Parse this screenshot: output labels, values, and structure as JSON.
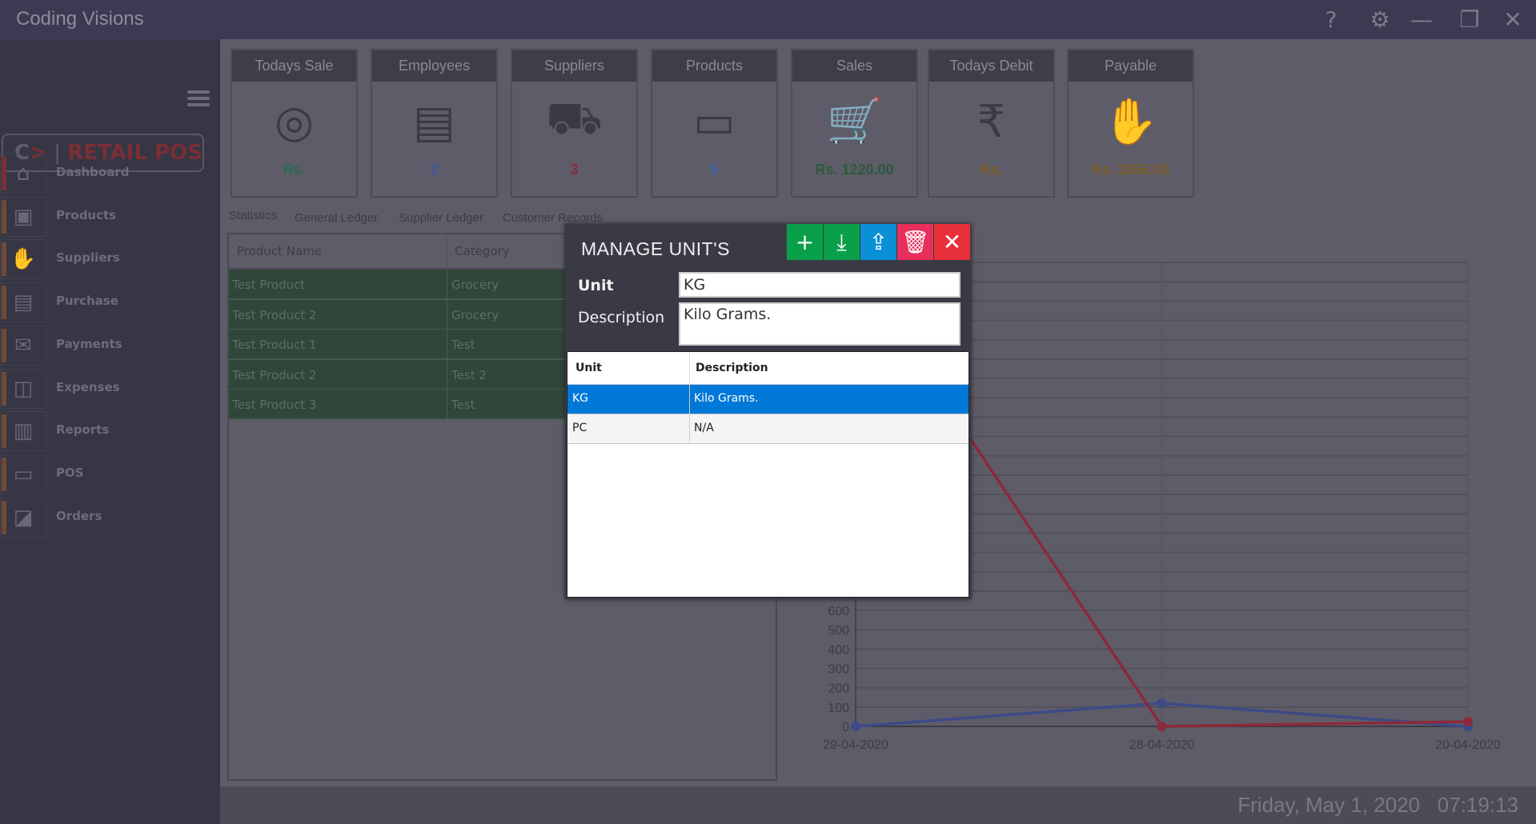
{
  "app": {
    "title": "Coding Visions",
    "logo_text": "C> | RETAIL POS"
  },
  "window_controls": [
    {
      "name": "help-icon",
      "glyph": "?"
    },
    {
      "name": "settings-icon",
      "glyph": "⚙"
    },
    {
      "name": "minimize-icon",
      "glyph": "—"
    },
    {
      "name": "maximize-icon",
      "glyph": "❐"
    },
    {
      "name": "close-icon",
      "glyph": "✕"
    }
  ],
  "sidebar": {
    "items": [
      {
        "label": "Dashboard",
        "icon": "home-icon",
        "glyph": "⌂",
        "accent": "#7a2e36"
      },
      {
        "label": "Products",
        "icon": "box-icon",
        "glyph": "▣",
        "accent": "#6e4a36"
      },
      {
        "label": "Suppliers",
        "icon": "handshake-icon",
        "glyph": "✋",
        "accent": "#6e4a36"
      },
      {
        "label": "Purchase",
        "icon": "purchase-icon",
        "glyph": "▤",
        "accent": "#6e4a36"
      },
      {
        "label": "Payments",
        "icon": "payment-icon",
        "glyph": "✉",
        "accent": "#6e4a36"
      },
      {
        "label": "Expenses",
        "icon": "wallet-icon",
        "glyph": "◫",
        "accent": "#6e4a36"
      },
      {
        "label": "Reports",
        "icon": "report-icon",
        "glyph": "▥",
        "accent": "#6e4a36"
      },
      {
        "label": "POS",
        "icon": "pos-monitor-icon",
        "glyph": "▭",
        "accent": "#6e4a36"
      },
      {
        "label": "Orders",
        "icon": "orders-icon",
        "glyph": "◪",
        "accent": "#6e4a36"
      }
    ]
  },
  "cards": [
    {
      "title": "Todays Sale",
      "value": "Rs.",
      "icon": "money-safe-icon",
      "glyph": "◎",
      "color": "#2e6a52"
    },
    {
      "title": "Employees",
      "value": "2",
      "icon": "id-card-icon",
      "glyph": "▤",
      "color": "#3e56a0"
    },
    {
      "title": "Suppliers",
      "value": "3",
      "icon": "truck-icon",
      "glyph": "⛟",
      "color": "#8e2a3a"
    },
    {
      "title": "Products",
      "value": "5",
      "icon": "laptop-icon",
      "glyph": "▭",
      "color": "#3e66a8"
    },
    {
      "title": "Sales",
      "value": "Rs. 1220.00",
      "icon": "cart-icon",
      "glyph": "🛒",
      "color": "#2e5a3c"
    },
    {
      "title": "Todays Debit",
      "value": "Rs.",
      "icon": "rupee-notes-icon",
      "glyph": "₹",
      "color": "#7a5a2a"
    },
    {
      "title": "Payable",
      "value": "Rs. 2856.00",
      "icon": "hand-coin-icon",
      "glyph": "✋",
      "color": "#7a5a2a"
    }
  ],
  "tabs": [
    "Statistics",
    "General Ledger",
    "Supplier Ledger",
    "Customer Records"
  ],
  "products_table": {
    "columns": [
      "Product Name",
      "Category"
    ],
    "rows": [
      [
        "Test Product",
        "Grocery"
      ],
      [
        "Test Product 2",
        "Grocery"
      ],
      [
        "Test Product 1",
        "Test"
      ],
      [
        "Test Product 2",
        "Test 2"
      ],
      [
        "Test Product 3",
        "Test"
      ]
    ]
  },
  "dialog": {
    "title": "MANAGE UNIT'S",
    "unit_label": "Unit",
    "unit_value": "KG",
    "description_label": "Description",
    "description_value": "Kilo Grams.",
    "buttons": [
      {
        "name": "add-button",
        "glyph": "+",
        "color": "#0aa04a"
      },
      {
        "name": "save-button",
        "glyph": "⤓",
        "color": "#0aa04a"
      },
      {
        "name": "update-button",
        "glyph": "⇪",
        "color": "#0a90d4"
      },
      {
        "name": "delete-button",
        "glyph": "🗑",
        "color": "#e82e5a"
      },
      {
        "name": "close-button",
        "glyph": "✕",
        "color": "#e8303a"
      }
    ],
    "grid": {
      "columns": [
        "Unit",
        "Description"
      ],
      "rows": [
        [
          "KG",
          "Kilo Grams."
        ],
        [
          "PC",
          "N/A"
        ]
      ],
      "selected_row": 0,
      "selected_color": "#0078d7"
    }
  },
  "chart_data": {
    "type": "line",
    "x": [
      "29-04-2020",
      "28-04-2020",
      "20-04-2020"
    ],
    "yticks": [
      0,
      100,
      200,
      300,
      400,
      500,
      600
    ],
    "ylim": [
      0,
      2400
    ],
    "grid": true,
    "series": [
      {
        "values": [
          0,
          120,
          0
        ],
        "color": "#3e4a88"
      },
      {
        "values": [
          2380,
          0,
          25
        ],
        "color": "#8a2a3a"
      }
    ]
  },
  "status": {
    "date": "Friday, May 1, 2020",
    "time": "07:19:13"
  }
}
